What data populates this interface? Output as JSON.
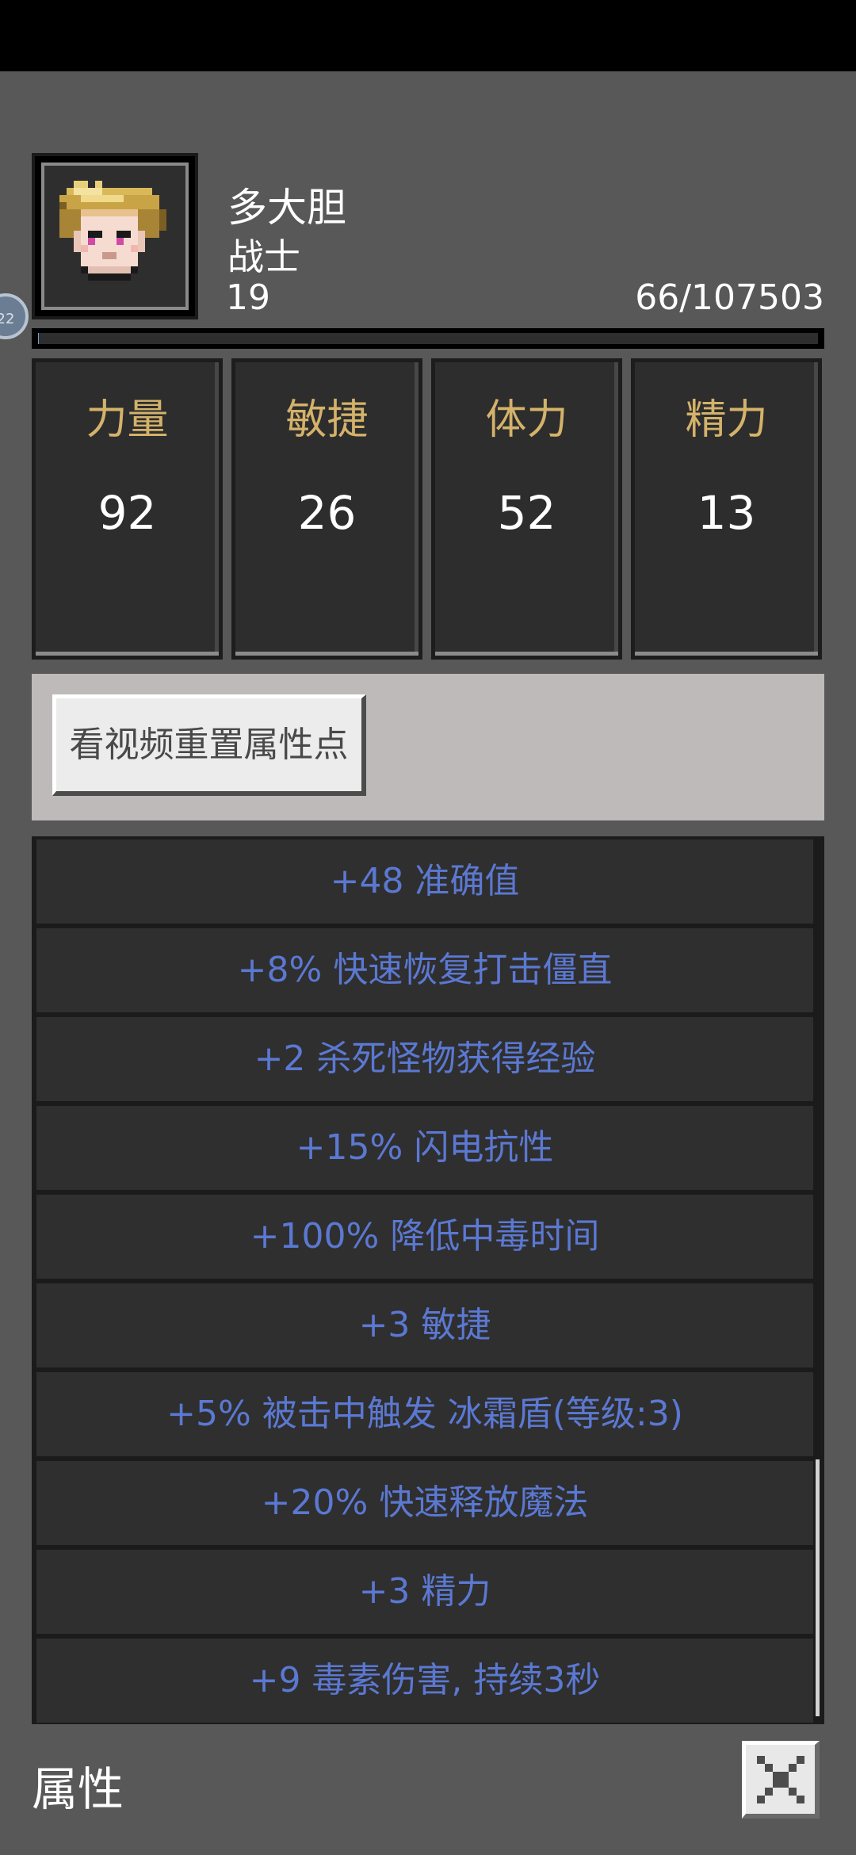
{
  "hero": {
    "name": "多大胆",
    "class": "战士",
    "level": "19",
    "exp": "66/107503",
    "exp_fraction": 0.0006
  },
  "side_badge": "22",
  "stats": [
    {
      "label": "力量",
      "value": "92"
    },
    {
      "label": "敏捷",
      "value": "26"
    },
    {
      "label": "体力",
      "value": "52"
    },
    {
      "label": "精力",
      "value": "13"
    }
  ],
  "reset_button": "看视频重置属性点",
  "attributes": [
    "+48 准确值",
    "+8% 快速恢复打击僵直",
    "+2 杀死怪物获得经验",
    "+15% 闪电抗性",
    "+100% 降低中毒时间",
    "+3 敏捷",
    "+5% 被击中触发 冰霜盾(等级:3)",
    "+20% 快速释放魔法",
    "+3 精力",
    "+9 毒素伤害, 持续3秒"
  ],
  "footer": {
    "title": "属性"
  },
  "icons": {
    "portrait": "hero-portrait-icon",
    "close": "close-icon"
  },
  "colors": {
    "stat_label": "#d4b26a",
    "attribute_text": "#5b78d2",
    "panel": "#2d2d2d",
    "background": "#585858"
  }
}
